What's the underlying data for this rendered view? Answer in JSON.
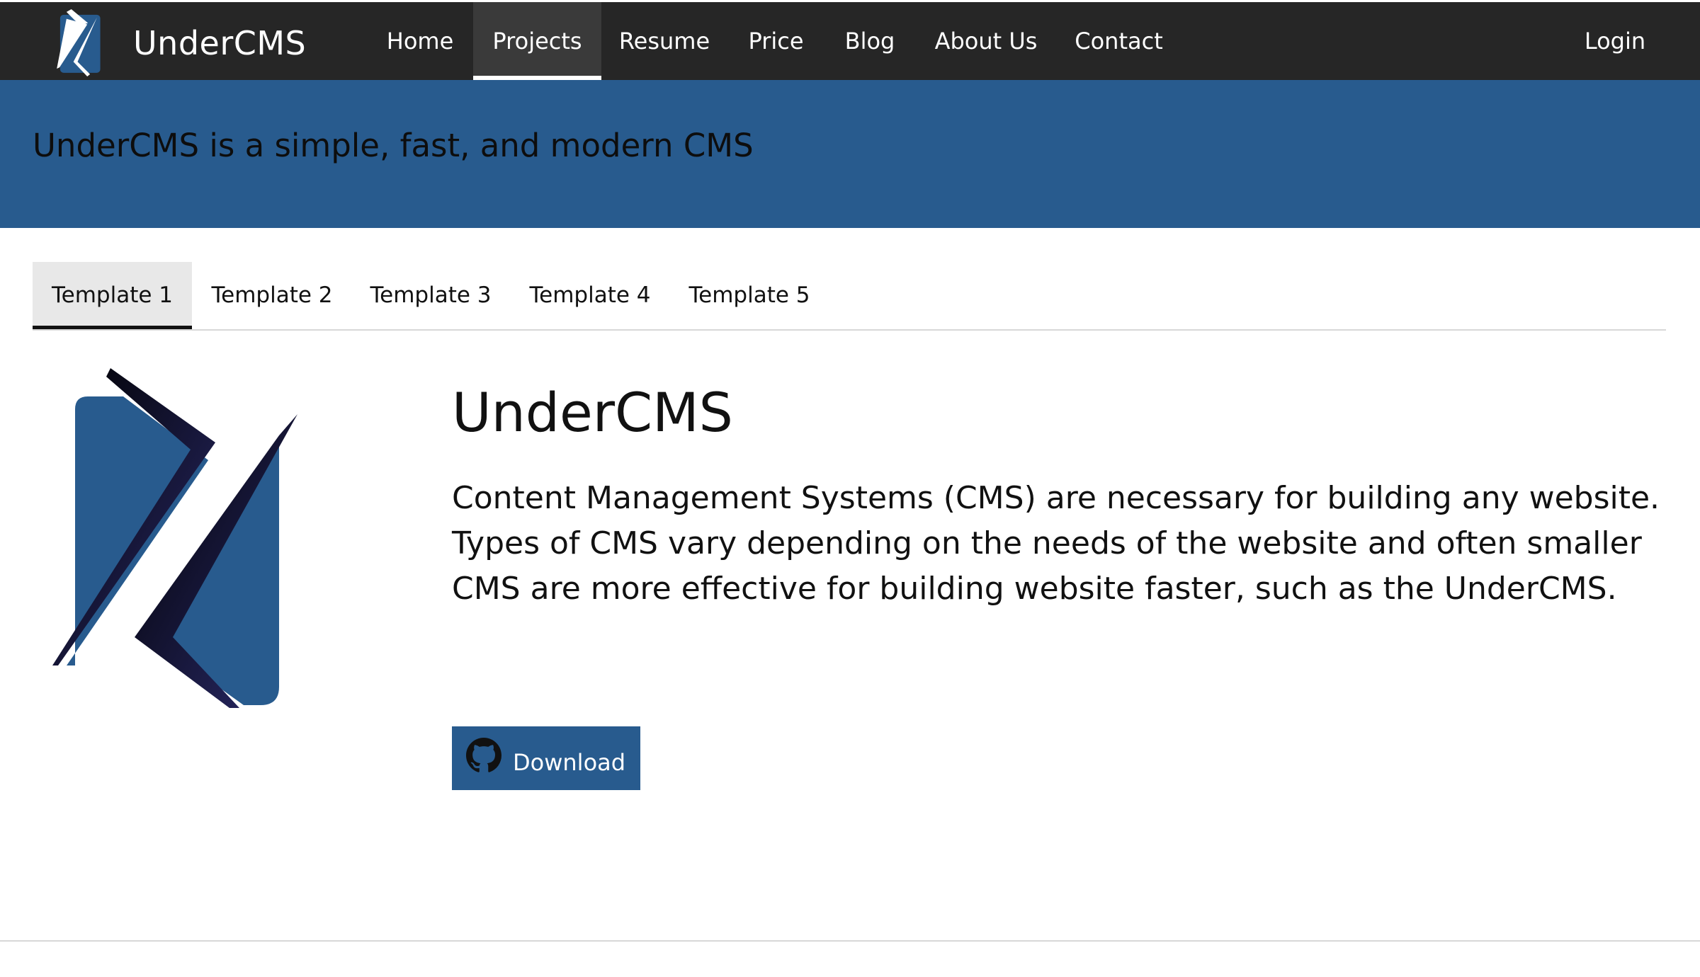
{
  "navbar": {
    "brand": "UnderCMS",
    "items": [
      {
        "label": "Home",
        "active": false
      },
      {
        "label": "Projects",
        "active": true
      },
      {
        "label": "Resume",
        "active": false
      },
      {
        "label": "Price",
        "active": false
      },
      {
        "label": "Blog",
        "active": false
      },
      {
        "label": "About Us",
        "active": false
      },
      {
        "label": "Contact",
        "active": false
      }
    ],
    "login": "Login"
  },
  "hero": {
    "tagline": "UnderCMS is a simple, fast, and modern CMS"
  },
  "tabs": [
    {
      "label": "Template 1",
      "active": true
    },
    {
      "label": "Template 2",
      "active": false
    },
    {
      "label": "Template 3",
      "active": false
    },
    {
      "label": "Template 4",
      "active": false
    },
    {
      "label": "Template 5",
      "active": false
    }
  ],
  "panel": {
    "title": "UnderCMS",
    "description": "Content Management Systems (CMS) are necessary for building any website. Types of CMS vary depending on the needs of the website and often smaller CMS are more effective for building website faster, such as the UnderCMS.",
    "download_label": "Download",
    "download_icon": "github-icon"
  },
  "colors": {
    "navbar_bg": "#262626",
    "brand_blue": "#285b8e",
    "tab_active_bg": "#e8e8e8"
  }
}
